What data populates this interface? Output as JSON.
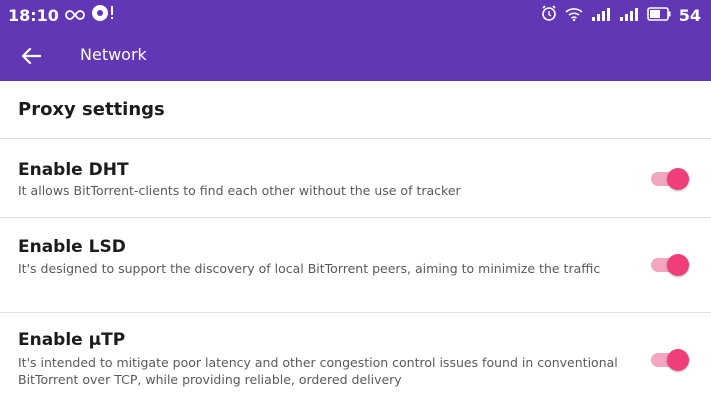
{
  "status_bar": {
    "time": "18:10",
    "battery": "54",
    "icons": [
      "infinity-icon",
      "download-badge-icon",
      "alarm-icon",
      "wifi-icon",
      "signal-icon",
      "signal-icon",
      "battery-icon"
    ]
  },
  "app_bar": {
    "title": "Network",
    "back_icon": "arrow-left-icon"
  },
  "section": {
    "title": "Proxy settings"
  },
  "preferences": [
    {
      "title": "Enable DHT",
      "summary": "It allows BitTorrent-clients to find each other without the use of tracker",
      "enabled": true
    },
    {
      "title": "Enable LSD",
      "summary": "It's designed to support the discovery of local BitTorrent peers, aiming to minimize the traffic",
      "enabled": true
    },
    {
      "title": "Enable µTP",
      "summary": "It's intended to mitigate poor latency and other congestion control issues found in conventional BitTorrent over TCP, while providing reliable, ordered delivery",
      "enabled": true
    }
  ],
  "colors": {
    "primary": "#6237b6",
    "accent": "#f03e78",
    "accent_track": "#f3a6bf"
  }
}
